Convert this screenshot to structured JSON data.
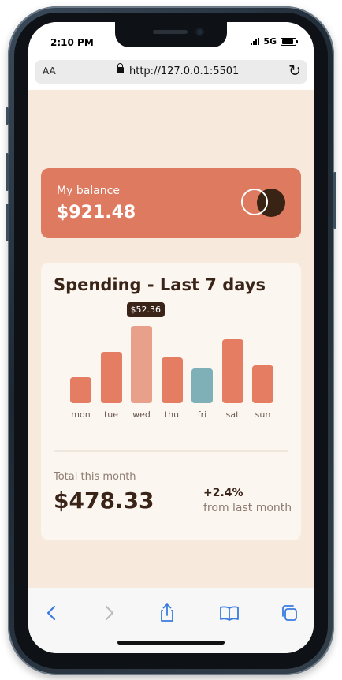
{
  "status_bar": {
    "time": "2:10 PM",
    "network": "5G"
  },
  "browser": {
    "aa_label": "AA",
    "url": "http://127.0.0.1:5501",
    "reload_icon": "reload-icon",
    "lock_icon": "lock-icon"
  },
  "balance": {
    "label": "My balance",
    "value": "$921.48",
    "logo_icon": "card-logo-icon"
  },
  "spending": {
    "title": "Spending - Last 7 days",
    "tooltip": "$52.36",
    "total_label": "Total this month",
    "total_value": "$478.33",
    "change_value": "+2.4%",
    "change_label": "from last month"
  },
  "colors": {
    "background": "#f8e9dd",
    "card": "#fbf6f0",
    "bar": "#e47d62",
    "bar_max": "#e9a08a",
    "bar_today": "#7fb0b8",
    "dark": "#3a2418",
    "accent": "#de7a60"
  },
  "chart_data": {
    "type": "bar",
    "categories": [
      "mon",
      "tue",
      "wed",
      "thu",
      "fri",
      "sat",
      "sun"
    ],
    "values": [
      17.45,
      34.91,
      52.36,
      31.07,
      23.39,
      43.28,
      25.48
    ],
    "highlight_max": "wed",
    "highlight_today": "fri",
    "ylim": [
      0,
      52.36
    ],
    "grid": false
  },
  "toolbar": {
    "items": [
      "back-icon",
      "forward-icon",
      "share-icon",
      "bookmarks-icon",
      "tabs-icon"
    ]
  }
}
